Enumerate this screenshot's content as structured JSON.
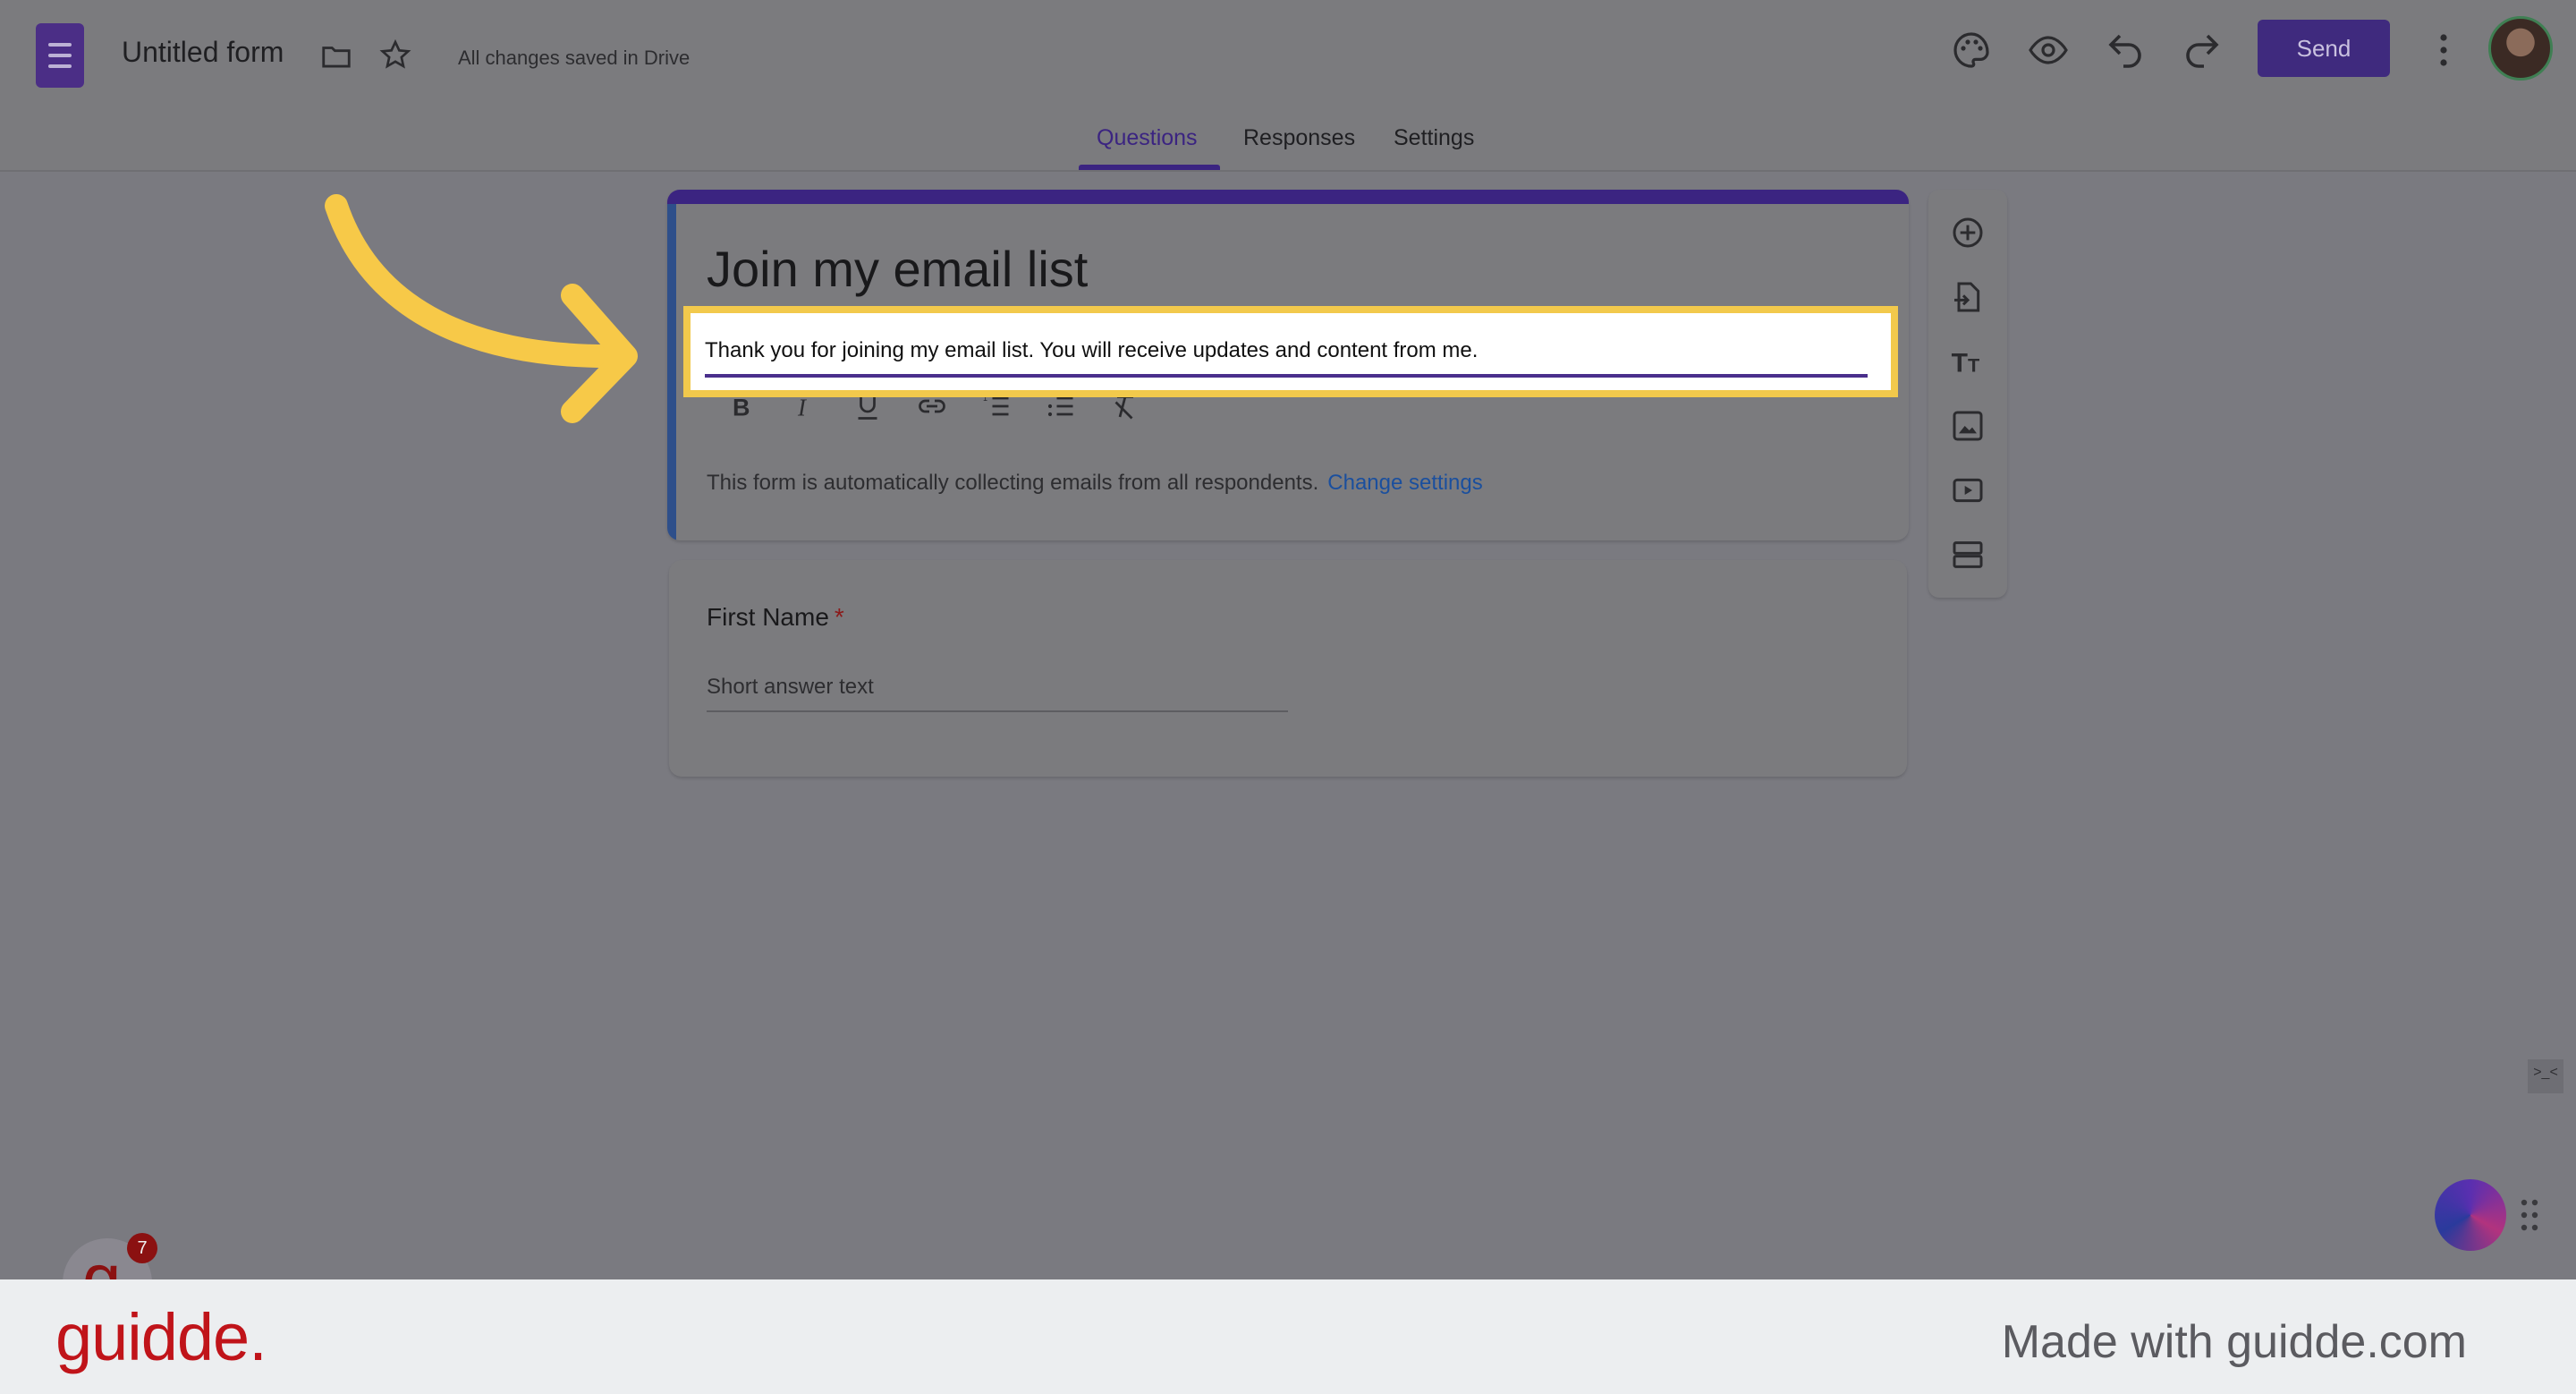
{
  "header": {
    "doc_title": "Untitled form",
    "saved_status": "All changes saved in Drive",
    "send_label": "Send"
  },
  "tabs": [
    {
      "label": "Questions",
      "active": true
    },
    {
      "label": "Responses",
      "active": false
    },
    {
      "label": "Settings",
      "active": false
    }
  ],
  "form": {
    "title": "Join my email list",
    "description": "Thank you for joining my email list. You will receive updates and content from me.",
    "notice_text": "This form is automatically collecting emails from all respondents.",
    "notice_link": "Change settings"
  },
  "question": {
    "title": "First Name",
    "required_mark": "*",
    "hint": "Short answer text"
  },
  "side_toolbar": [
    "add-question-icon",
    "import-questions-icon",
    "add-title-icon",
    "add-image-icon",
    "add-video-icon",
    "add-section-icon"
  ],
  "format_toolbar": [
    "bold-icon",
    "italic-icon",
    "underline-icon",
    "link-icon",
    "numbered-list-icon",
    "bulleted-list-icon",
    "clear-formatting-icon"
  ],
  "badge": {
    "letter": "g",
    "count": "7"
  },
  "footer": {
    "logo": "guidde.",
    "made_with": "Made with guidde.com"
  },
  "colors": {
    "accent": "#3b2481",
    "highlight": "#f2c94c",
    "arrow": "#f7c948",
    "brand_red": "#c0141a"
  }
}
